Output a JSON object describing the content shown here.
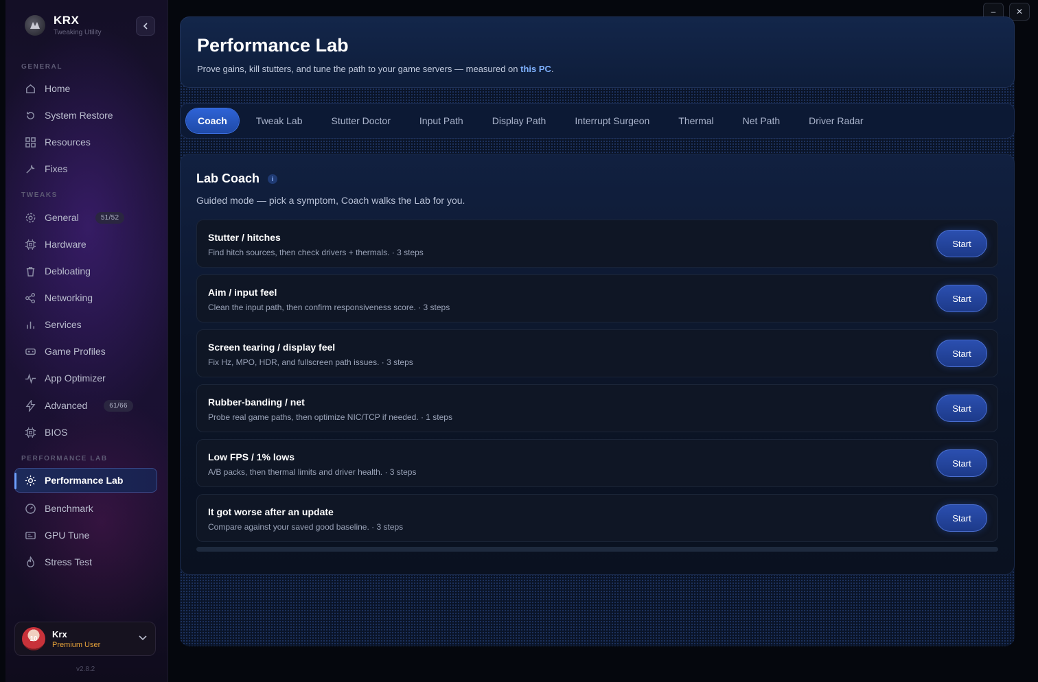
{
  "window": {
    "minimize_icon": "minimize-icon",
    "close_icon": "close-icon",
    "minimize_glyph": "–",
    "close_glyph": "✕"
  },
  "brand": {
    "name": "KRX",
    "subtitle": "Tweaking Utility"
  },
  "sidebar": {
    "sections": {
      "general": "GENERAL",
      "tweaks": "TWEAKS",
      "performance": "PERFORMANCE LAB"
    },
    "items": [
      {
        "label": "Home",
        "icon": "home-icon"
      },
      {
        "label": "System Restore",
        "icon": "restore-icon"
      },
      {
        "label": "Resources",
        "icon": "grid-icon"
      },
      {
        "label": "Fixes",
        "icon": "wrench-icon"
      },
      {
        "label": "General",
        "icon": "gear-icon",
        "badge": "51/52"
      },
      {
        "label": "Hardware",
        "icon": "chip-icon"
      },
      {
        "label": "Debloating",
        "icon": "trash-icon"
      },
      {
        "label": "Networking",
        "icon": "share-icon"
      },
      {
        "label": "Services",
        "icon": "bars-icon"
      },
      {
        "label": "Game Profiles",
        "icon": "gamepad-icon"
      },
      {
        "label": "App Optimizer",
        "icon": "pulse-icon"
      },
      {
        "label": "Advanced",
        "icon": "bolt-icon",
        "badge": "61/66"
      },
      {
        "label": "BIOS",
        "icon": "chip-icon"
      },
      {
        "label": "Performance Lab",
        "icon": "sun-icon",
        "active": true
      },
      {
        "label": "Benchmark",
        "icon": "gauge-icon"
      },
      {
        "label": "GPU Tune",
        "icon": "gpu-icon"
      },
      {
        "label": "Stress Test",
        "icon": "flame-icon"
      }
    ]
  },
  "user": {
    "name": "Krx",
    "role": "Premium User",
    "avatar_text": "10"
  },
  "version": "v2.8.2",
  "header": {
    "title": "Performance Lab",
    "subtitle_prefix": "Prove gains, kill stutters, and tune the path to your game servers — measured on ",
    "subtitle_highlight": "this PC",
    "subtitle_suffix": "."
  },
  "tabs": [
    {
      "label": "Coach",
      "active": true
    },
    {
      "label": "Tweak Lab"
    },
    {
      "label": "Stutter Doctor"
    },
    {
      "label": "Input Path"
    },
    {
      "label": "Display Path"
    },
    {
      "label": "Interrupt Surgeon"
    },
    {
      "label": "Thermal"
    },
    {
      "label": "Net Path"
    },
    {
      "label": "Driver Radar"
    }
  ],
  "coach": {
    "title": "Lab Coach",
    "info_glyph": "i",
    "subtitle": "Guided mode — pick a symptom, Coach walks the Lab for you.",
    "start_label": "Start",
    "symptoms": [
      {
        "title": "Stutter / hitches",
        "desc": "Find hitch sources, then check drivers + thermals. · 3 steps"
      },
      {
        "title": "Aim / input feel",
        "desc": "Clean the input path, then confirm responsiveness score. · 3 steps"
      },
      {
        "title": "Screen tearing / display feel",
        "desc": "Fix Hz, MPO, HDR, and fullscreen path issues. · 3 steps"
      },
      {
        "title": "Rubber-banding / net",
        "desc": "Probe real game paths, then optimize NIC/TCP if needed. · 1 steps"
      },
      {
        "title": "Low FPS / 1% lows",
        "desc": "A/B packs, then thermal limits and driver health. · 3 steps"
      },
      {
        "title": "It got worse after an update",
        "desc": "Compare against your saved good baseline. · 3 steps"
      }
    ]
  },
  "colors": {
    "accent": "#2e63d6",
    "highlight": "#7fb1ff",
    "premium": "#e6a23a"
  }
}
